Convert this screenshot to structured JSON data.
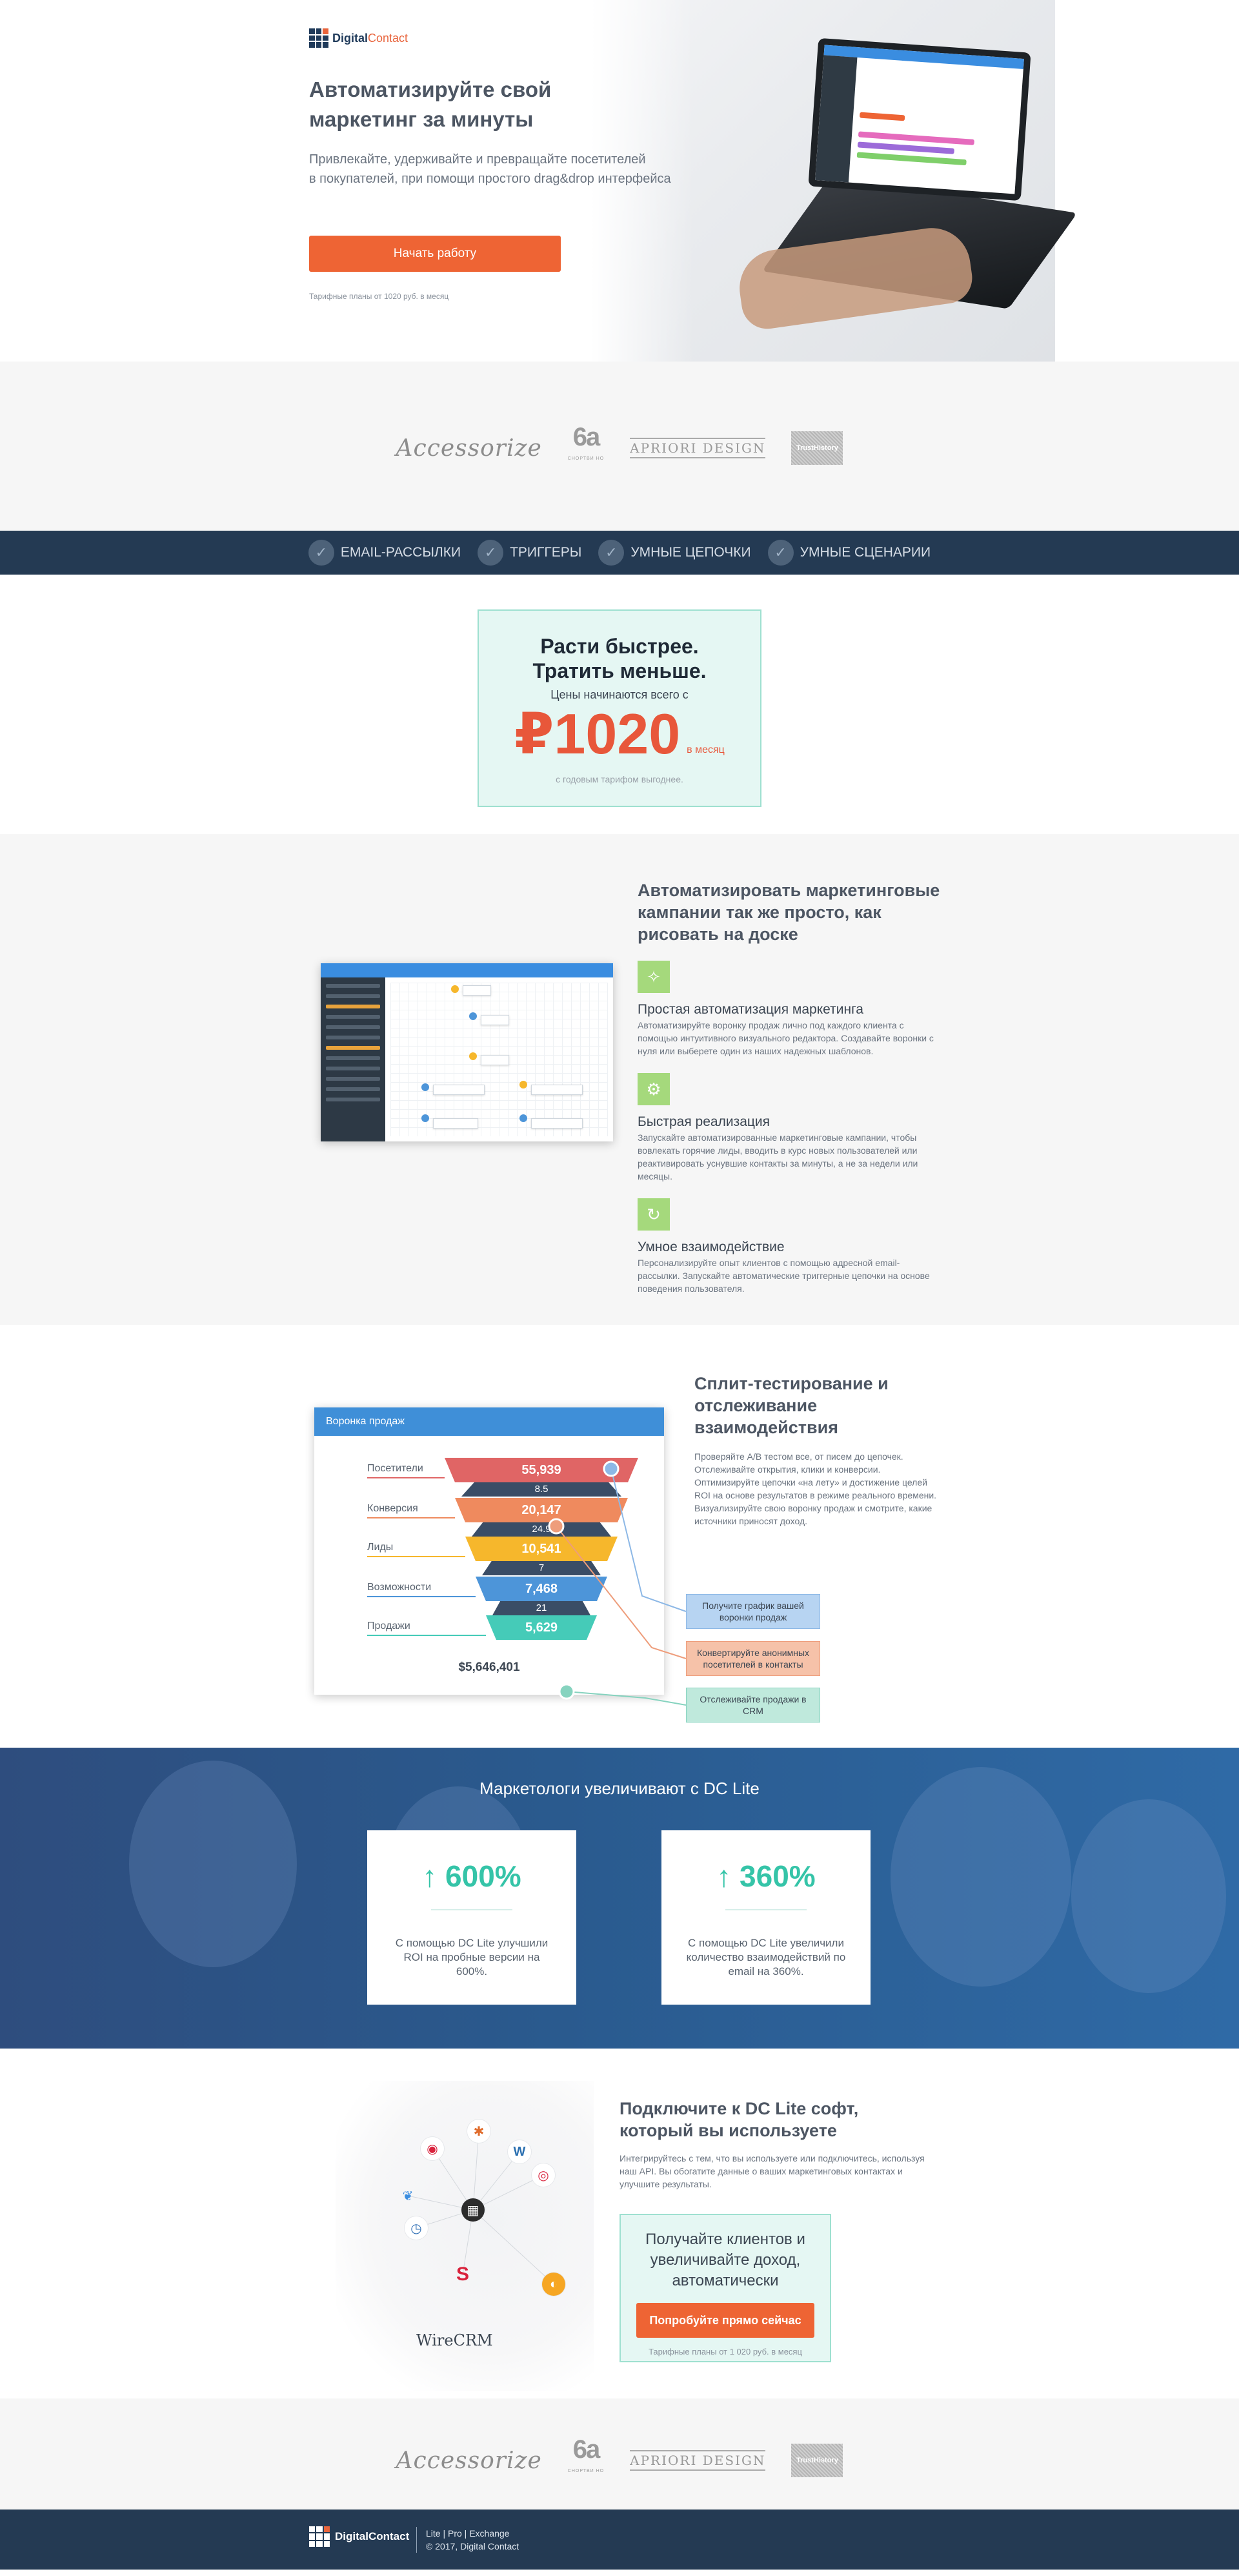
{
  "hero": {
    "logo_main": "Digital",
    "logo_accent": "Contact",
    "title": "Автоматизируйте свой маркетинг за минуты",
    "subtitle_line1": "Привлекайте, удерживайте и превращайте посетителей",
    "subtitle_line2": "в покупателей, при помощи простого drag&drop интерфейса",
    "cta": "Начать работу",
    "note": "Тарифные планы от 1020 руб. в месяц"
  },
  "clients": {
    "items": [
      "Accessorize",
      "6a",
      "APRIORI DESIGN",
      "TrustHistory"
    ],
    "bottom_small": "СНОРТВИ НО"
  },
  "features_bar": [
    "EMAIL-РАССЫЛКИ",
    "ТРИГГЕРЫ",
    "УМНЫЕ ЦЕПОЧКИ",
    "УМНЫЕ СЦЕНАРИИ"
  ],
  "pricing": {
    "title_line1": "Расти быстрее.",
    "title_line2": "Тратить меньше.",
    "subtitle": "Цены начинаются всего с",
    "amount": "₽1020",
    "per": "в месяц",
    "note": "с годовым тарифом выгоднее."
  },
  "automation": {
    "title": "Автоматизировать маркетинговые кампании так же просто, как рисовать на доске",
    "features": [
      {
        "icon": "magic-wand-icon",
        "title": "Простая автоматизация маркетинга",
        "desc": "Автоматизируйте воронку продаж лично под каждого клиента с помощью интуитивного визуального редактора. Создавайте воронки с нуля или выберете один из наших надежных шаблонов."
      },
      {
        "icon": "gear-icon",
        "title": "Быстрая реализация",
        "desc": "Запускайте автоматизированные маркетинговые кампании, чтобы вовлекать горячие лиды, вводить в курс новых пользователей или реактивировать уснувшие контакты за минуты, а не за недели или месяцы."
      },
      {
        "icon": "refresh-icon",
        "title": "Умное взаимодействие",
        "desc": "Персонализируйте опыт клиентов с помощью адресной email-рассылки. Запускайте автоматические триггерные цепочки на основе поведения пользователя."
      }
    ]
  },
  "funnel": {
    "card_title": "Воронка продаж",
    "stages": [
      {
        "label": "Посетители",
        "value": "55,939",
        "color": "#e06565"
      },
      {
        "label": "Конверсия",
        "value": "20,147",
        "color": "#ef8a5e"
      },
      {
        "label": "Лиды",
        "value": "10,541",
        "color": "#f6b72c"
      },
      {
        "label": "Возможности",
        "value": "7,468",
        "color": "#4d95d9"
      },
      {
        "label": "Продажи",
        "value": "5,629",
        "color": "#45cbb8"
      }
    ],
    "conversions": [
      "8.5",
      "24.9",
      "7",
      "21"
    ],
    "total": "$5,646,401",
    "callouts": [
      {
        "text": "Получите график вашей воронки продаж",
        "bg": "#b7d4f2",
        "border": "#8db8e6"
      },
      {
        "text": "Конвертируйте анонимных посетителей в контакты",
        "bg": "#f6c2a9",
        "border": "#ee9d7b"
      },
      {
        "text": "Отслеживайте продажи в CRM",
        "bg": "#bfe9dc",
        "border": "#86d3bf"
      }
    ],
    "title": "Сплит-тестирование и отслеживание взаимодействия",
    "desc": "Проверяйте А/В тестом все, от писем до цепочек. Отслеживайте открытия, клики и конверсии. Оптимизируйте цепочки «на лету» и достижение целей ROI на основе результатов в режиме реального времени. Визуализируйте свою воронку продаж и смотрите, какие источники приносят доход."
  },
  "stats": {
    "title": "Маркетологи увеличивают с DC Lite",
    "items": [
      {
        "value": "↑ 600%",
        "desc": "С помощью DC Lite улучшили ROI на пробные версии на 600%."
      },
      {
        "value": "↑ 360%",
        "desc": "С помощью DC Lite увеличили количество взаимодействий по email на 360%."
      }
    ]
  },
  "integrations": {
    "brand": "WireCRM",
    "title": "Подключите к DC Lite софт, который вы используете",
    "desc": "Интегрируйтесь с тем, что вы используете или подключитесь, используя наш API. Вы обогатите данные о ваших маркетинговых контактах и улучшите результаты.",
    "cta_title": "Получайте клиентов и увеличивайте доход, автоматически",
    "cta_button": "Попробуйте прямо сейчас",
    "cta_note": "Тарифные планы от 1 020 руб. в месяц"
  },
  "footer": {
    "logo_main": "Digital",
    "logo_accent": "Contact",
    "links": "Lite | Pro | Exchange",
    "copyright": "© 2017, Digital Contact"
  },
  "colors": {
    "accent": "#ee6434",
    "navy": "#243a53",
    "teal": "#35c4a8"
  }
}
